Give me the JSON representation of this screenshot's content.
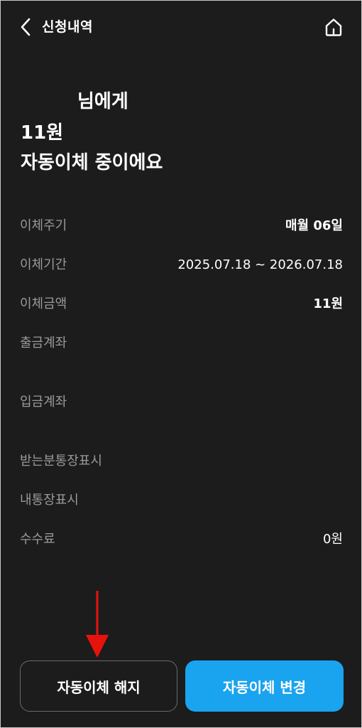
{
  "header": {
    "title": "신청내역"
  },
  "headline": {
    "line1": "님에게",
    "line2": "11원",
    "line3": "자동이체 중이에요"
  },
  "details": [
    {
      "label": "이체주기",
      "value": "매월 06일"
    },
    {
      "label": "이체기간",
      "value": "2025.07.18 ~ 2026.07.18"
    },
    {
      "label": "이체금액",
      "value": "11원"
    },
    {
      "label": "출금계좌",
      "value": ""
    },
    {
      "label": "입금계좌",
      "value": ""
    },
    {
      "label": "받는분통장표시",
      "value": ""
    },
    {
      "label": "내통장표시",
      "value": ""
    },
    {
      "label": "수수료",
      "value": "0원"
    }
  ],
  "buttons": {
    "cancel": "자동이체 해지",
    "change": "자동이체 변경"
  },
  "colors": {
    "background": "#1c1c1c",
    "primary": "#1aa3ef",
    "annotation_arrow": "#e8120c"
  },
  "icons": {
    "back": "chevron-left-icon",
    "home": "home-icon"
  }
}
